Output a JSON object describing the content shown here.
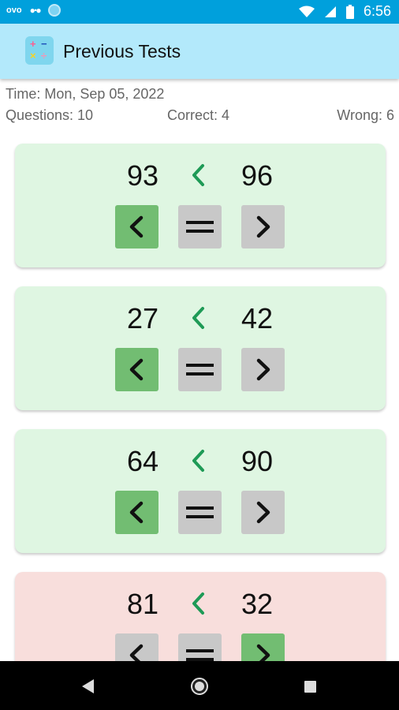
{
  "status_bar": {
    "left_label": "ovo",
    "time": "6:56",
    "icons": [
      "dots-icon",
      "circle-icon",
      "wifi-icon",
      "signal-icon",
      "battery-icon"
    ]
  },
  "app_bar": {
    "title": "Previous Tests",
    "icon_symbols": [
      "+",
      "−",
      "×",
      "÷"
    ],
    "background": "#b3e9fb"
  },
  "test_info": {
    "time": "Time: Mon, Sep 05, 2022",
    "questions": "Questions: 10",
    "correct": "Correct: 4",
    "wrong": "Wrong: 6"
  },
  "colors": {
    "correct_card": "#dff6e2",
    "wrong_card": "#f8dedc",
    "selected_button": "#72bd72",
    "button": "#c8c8c8",
    "relation_symbol": "#1e9a56"
  },
  "questions": [
    {
      "a": "93",
      "b": "96",
      "relation": "<",
      "selected": "lt",
      "result": "correct"
    },
    {
      "a": "27",
      "b": "42",
      "relation": "<",
      "selected": "lt",
      "result": "correct"
    },
    {
      "a": "64",
      "b": "90",
      "relation": "<",
      "selected": "lt",
      "result": "correct"
    },
    {
      "a": "81",
      "b": "32",
      "relation": "<",
      "selected": "gt",
      "result": "wrong"
    }
  ],
  "buttons": {
    "less_than": "less-than-icon",
    "equals": "equals-icon",
    "greater_than": "greater-than-icon"
  },
  "nav_bar": {
    "icons": [
      "back-icon",
      "home-icon",
      "recents-icon"
    ]
  }
}
